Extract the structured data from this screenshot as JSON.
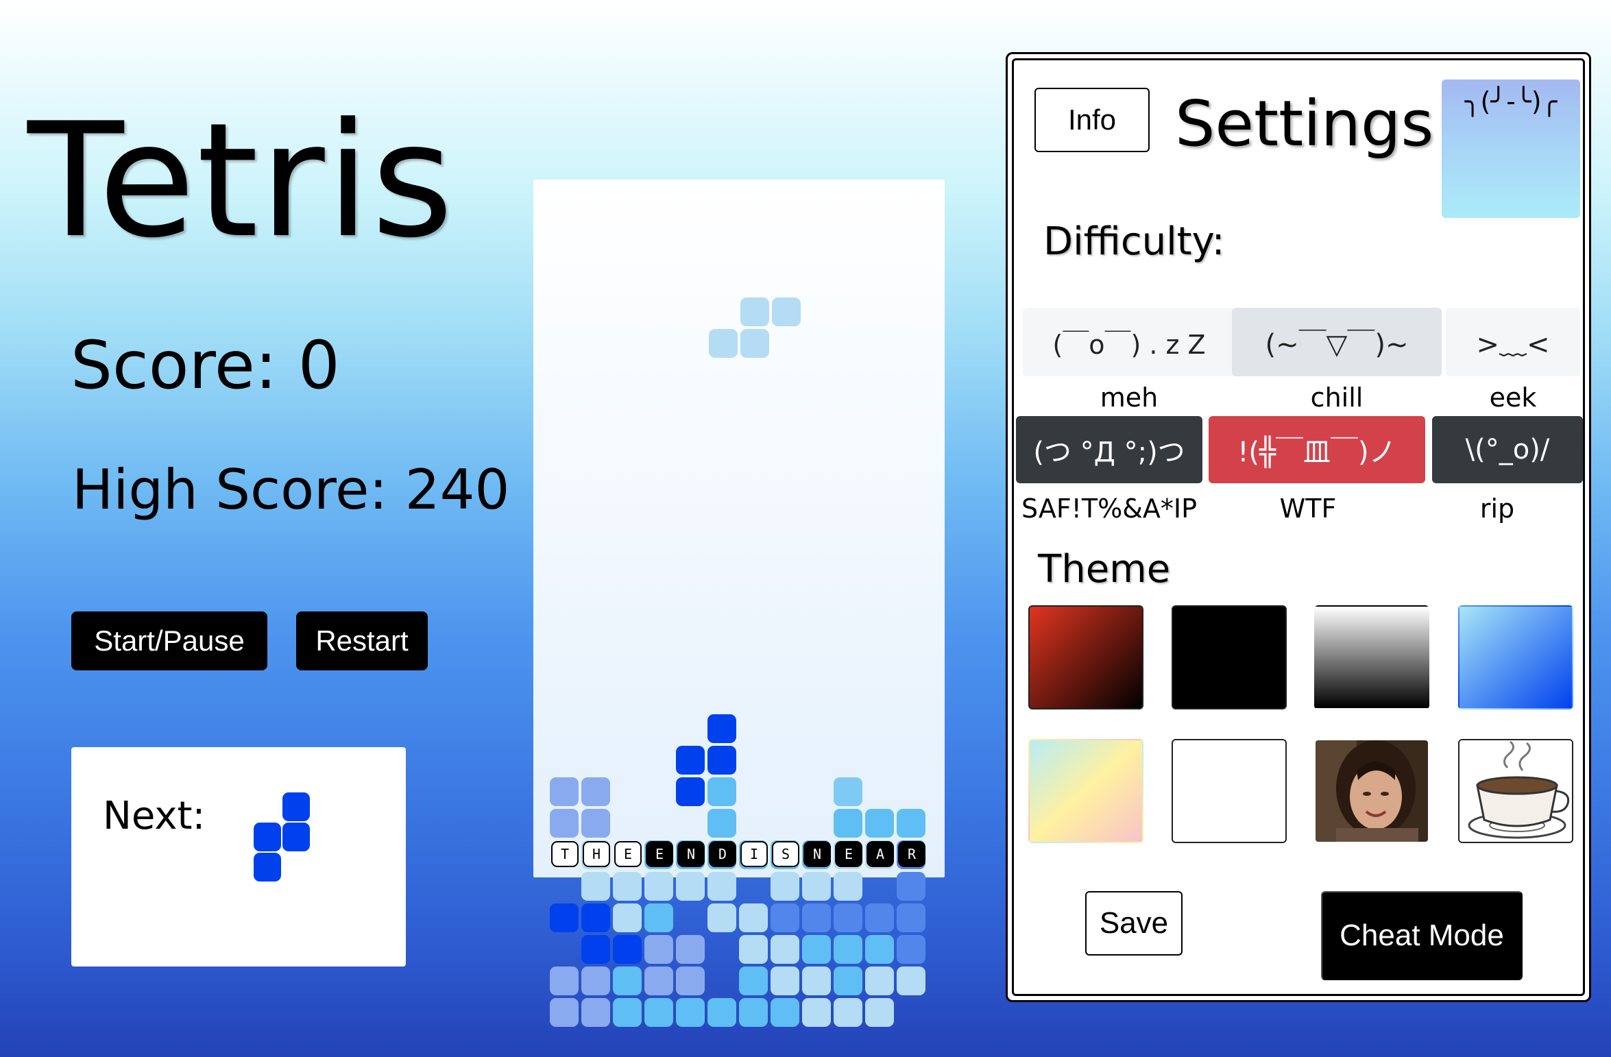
{
  "game": {
    "title": "Tetris",
    "score_text": "Score: 0",
    "score": 0,
    "high_score_text": "High Score: 240",
    "high_score": 240
  },
  "controls": {
    "start_pause_label": "Start/Pause",
    "restart_label": "Restart"
  },
  "next_piece": {
    "label": "Next:",
    "shape": "S-vertical",
    "color": "#0041ee"
  },
  "board": {
    "colors": {
      "1": "#b4dcf5",
      "2": "#8aaaf0",
      "3": "#5fbef3",
      "4": "#5286eb",
      "5": "#0041ee",
      "6": "#7ecaf4"
    },
    "falling_piece": {
      "shape": "S",
      "color": "#b4dcf5"
    },
    "cells": [
      [],
      [],
      [],
      [],
      [],
      [],
      [],
      [],
      [],
      [],
      [],
      [],
      [],
      [],
      [],
      [],
      [],
      [],
      [],
      [],
      [],
      [],
      [
        0,
        0,
        0,
        0,
        0,
        5,
        0,
        0,
        0,
        0,
        0,
        0
      ],
      [
        0,
        0,
        0,
        0,
        5,
        5,
        0,
        0,
        0,
        0,
        0,
        0
      ],
      [
        2,
        2,
        0,
        0,
        5,
        3,
        0,
        0,
        0,
        6,
        0,
        0
      ],
      [
        2,
        2,
        0,
        0,
        0,
        3,
        0,
        0,
        0,
        3,
        3,
        3
      ],
      [
        0,
        1,
        0,
        3,
        3,
        3,
        3,
        3,
        3,
        1,
        1,
        4
      ],
      [
        0,
        1,
        1,
        1,
        1,
        1,
        0,
        1,
        1,
        1,
        0,
        4
      ],
      [
        5,
        5,
        1,
        3,
        0,
        1,
        1,
        4,
        4,
        4,
        4,
        4
      ],
      [
        0,
        5,
        5,
        2,
        2,
        0,
        1,
        1,
        3,
        3,
        3,
        4
      ],
      [
        2,
        2,
        3,
        2,
        2,
        0,
        3,
        1,
        1,
        3,
        1,
        1
      ],
      [
        2,
        2,
        3,
        3,
        3,
        3,
        3,
        3,
        1,
        1,
        1,
        0
      ]
    ],
    "message_letters": [
      {
        "char": "T",
        "dark": false
      },
      {
        "char": "H",
        "dark": false
      },
      {
        "char": "E",
        "dark": false
      },
      {
        "char": "E",
        "dark": true
      },
      {
        "char": "N",
        "dark": true
      },
      {
        "char": "D",
        "dark": true
      },
      {
        "char": "I",
        "dark": false
      },
      {
        "char": "S",
        "dark": false
      },
      {
        "char": "N",
        "dark": true
      },
      {
        "char": "E",
        "dark": true
      },
      {
        "char": "A",
        "dark": true
      },
      {
        "char": "R",
        "dark": true
      }
    ]
  },
  "settings": {
    "info_label": "Info",
    "title": "Settings",
    "face": "╮(╯-╰)╭",
    "difficulty_label": "Difficulty:",
    "difficulties": [
      {
        "face": "(￣o￣) . z Z",
        "label": "meh",
        "style": "light"
      },
      {
        "face": "(~￣▽￣)~",
        "label": "chill",
        "style": "mid"
      },
      {
        "face": ">﹏<",
        "label": "eek",
        "style": "light"
      },
      {
        "face": "(つ °Д °;)つ",
        "label": "SAF!T%&A*IP",
        "style": "dark"
      },
      {
        "face": "!(╬￣皿￣)ノ",
        "label": "WTF",
        "style": "red"
      },
      {
        "face": "\\(°_o)/",
        "label": "rip",
        "style": "dark"
      }
    ],
    "theme_label": "Theme",
    "themes": [
      {
        "name": "red-black",
        "colors": [
          "#e03520",
          "#000000"
        ]
      },
      {
        "name": "black",
        "colors": [
          "#000000",
          "#000000"
        ]
      },
      {
        "name": "white-black",
        "colors": [
          "#ffffff",
          "#000000"
        ]
      },
      {
        "name": "blue",
        "colors": [
          "#0041ee",
          "#a8e6f8"
        ]
      },
      {
        "name": "pastel",
        "colors": [
          "#b8ecf5",
          "#fff1a0",
          "#f7c3c9"
        ]
      },
      {
        "name": "white",
        "colors": [
          "#ffffff",
          "#ffffff"
        ]
      },
      {
        "name": "photo",
        "colors": [
          "#4a3524"
        ]
      },
      {
        "name": "coffee",
        "colors": [
          "#ffffff"
        ]
      }
    ],
    "save_label": "Save",
    "cheat_mode_label": "Cheat Mode"
  }
}
